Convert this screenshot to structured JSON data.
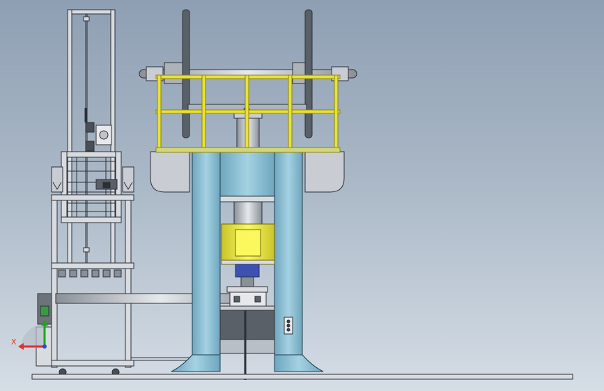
{
  "viewport": {
    "background_top": "#8f9fb3",
    "background_bottom": "#d5dde5"
  },
  "triad": {
    "x_label": "X",
    "y_label": "",
    "z_label": "",
    "x_color": "#e0322a",
    "y_color": "#1aa51a",
    "z_color": "#2b4ad6"
  },
  "colors": {
    "column_blue": "#8bbfd3",
    "motor_yellow": "#f0ee3c",
    "railing_yellow": "#e6e23a",
    "frame_gray": "#c9cdd3",
    "dark_steel": "#5a6068"
  }
}
